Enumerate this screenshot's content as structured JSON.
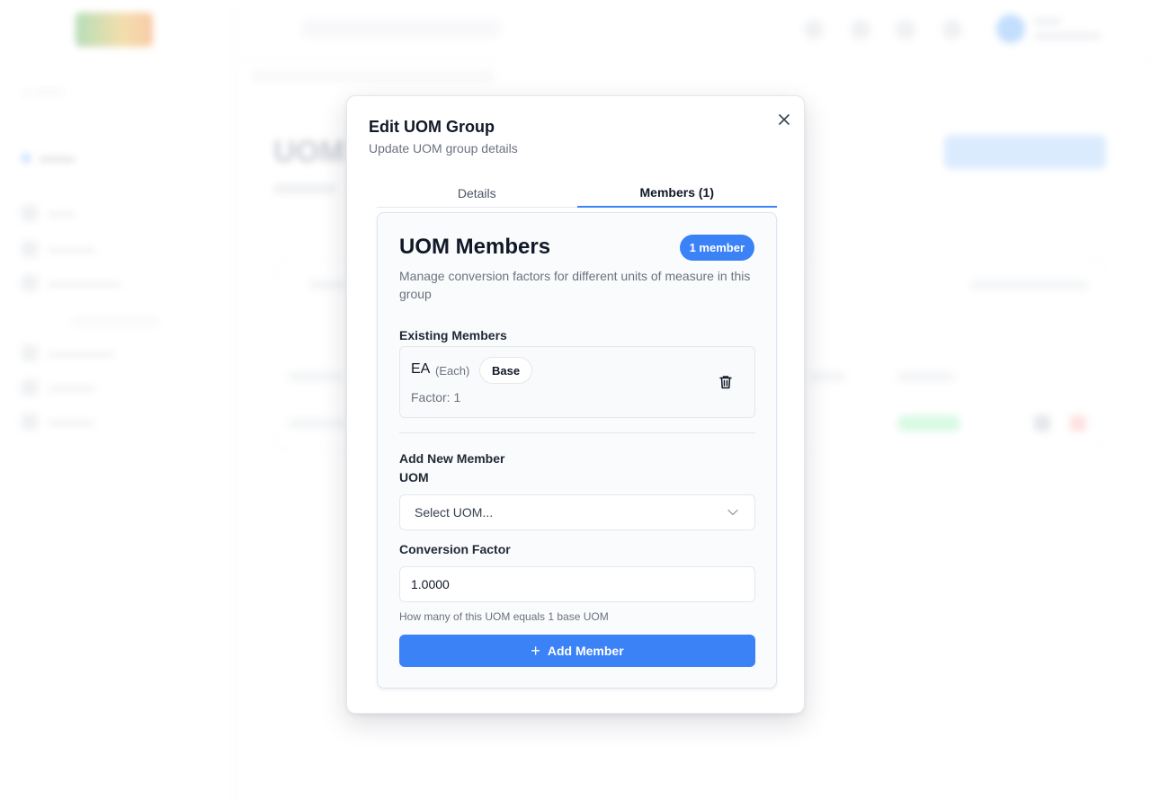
{
  "modal": {
    "title": "Edit UOM Group",
    "description": "Update UOM group details",
    "close_icon": "close-icon"
  },
  "tabs": [
    {
      "label": "Details",
      "active": false
    },
    {
      "label": "Members (1)",
      "active": true
    }
  ],
  "members_panel": {
    "title": "UOM Members",
    "count_badge": "1 member",
    "description": "Manage conversion factors for different units of measure in this group",
    "existing_label": "Existing Members",
    "members": [
      {
        "code": "EA",
        "name": "(Each)",
        "badge": "Base",
        "factor": "Factor: 1"
      }
    ],
    "add_section": {
      "title": "Add New Member",
      "uom_label": "UOM",
      "uom_placeholder": "Select UOM...",
      "factor_label": "Conversion Factor",
      "factor_value": "1.0000",
      "help_text": "How many of this UOM equals 1 base UOM",
      "add_button_label": "Add Member"
    }
  },
  "colors": {
    "accent": "#3b82f6",
    "text": "#111827",
    "muted": "#6b7280"
  }
}
